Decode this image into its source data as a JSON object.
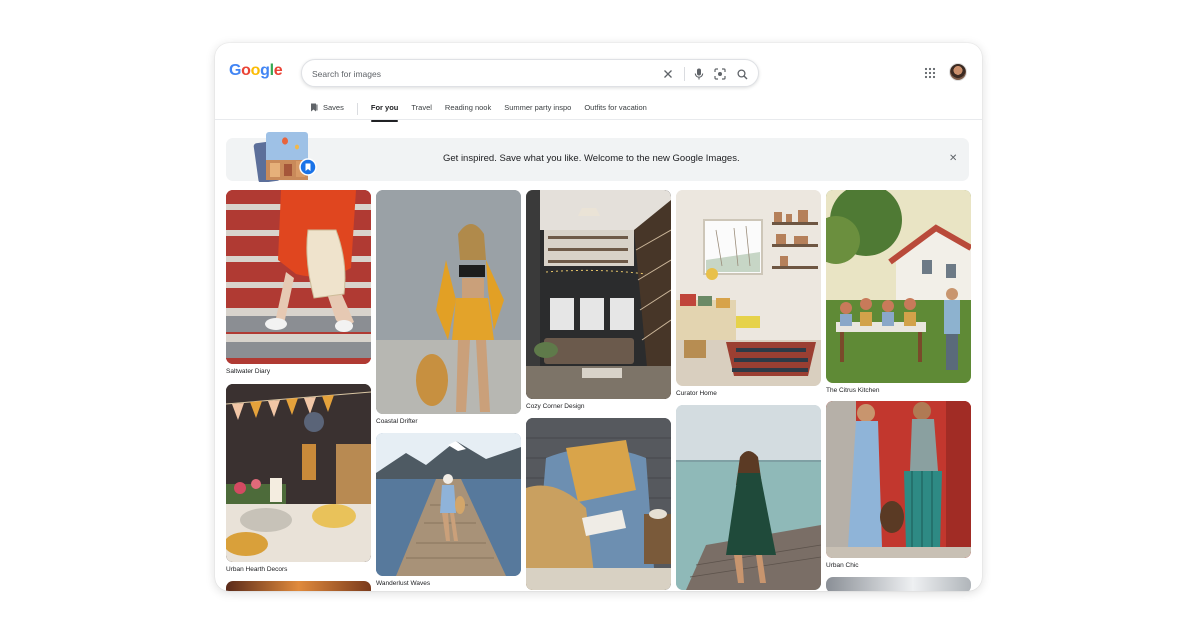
{
  "app": {
    "logo_letters": [
      {
        "ch": "G",
        "color": "#4285F4"
      },
      {
        "ch": "o",
        "color": "#EA4335"
      },
      {
        "ch": "o",
        "color": "#FBBC05"
      },
      {
        "ch": "g",
        "color": "#4285F4"
      },
      {
        "ch": "l",
        "color": "#34A853"
      },
      {
        "ch": "e",
        "color": "#EA4335"
      }
    ]
  },
  "search": {
    "placeholder": "Search for images",
    "icons": [
      "close-icon",
      "mic-icon",
      "lens-icon",
      "search-icon"
    ]
  },
  "header": {
    "icons": [
      "apps-grid-icon",
      "avatar"
    ]
  },
  "tabs": {
    "saves_label": "Saves",
    "items": [
      {
        "label": "For you",
        "active": true
      },
      {
        "label": "Travel",
        "active": false
      },
      {
        "label": "Reading nook",
        "active": false
      },
      {
        "label": "Summer party inspo",
        "active": false
      },
      {
        "label": "Outfits for vacation",
        "active": false
      }
    ]
  },
  "banner": {
    "text": "Get inspired. Save what you like. Welcome to the new Google Images.",
    "close_icon": "close-icon"
  },
  "grid": {
    "cards": [
      {
        "caption": "Saltwater Diary",
        "scene": "red-steps-fashion"
      },
      {
        "caption": "Urban Hearth Decors",
        "scene": "party-cushions"
      },
      {
        "caption": "",
        "scene": "warm-lights"
      },
      {
        "caption": "Coastal Drifter",
        "scene": "yellow-outfit"
      },
      {
        "caption": "Wanderlust Waves",
        "scene": "pier-lake"
      },
      {
        "caption": "Cozy Corner Design",
        "scene": "loft-interior"
      },
      {
        "caption": "",
        "scene": "yellow-pillow-chair"
      },
      {
        "caption": "Curator Home",
        "scene": "reading-nook-room"
      },
      {
        "caption": "",
        "scene": "green-dress-pier"
      },
      {
        "caption": "The Citrus Kitchen",
        "scene": "garden-dinner"
      },
      {
        "caption": "Urban Chic",
        "scene": "two-women-red-wall"
      },
      {
        "caption": "",
        "scene": "building-sky"
      }
    ]
  },
  "colors": {
    "accent": "#1a73e8",
    "text": "#202124",
    "muted": "#5f6368",
    "banner_bg": "#f1f3f4"
  }
}
